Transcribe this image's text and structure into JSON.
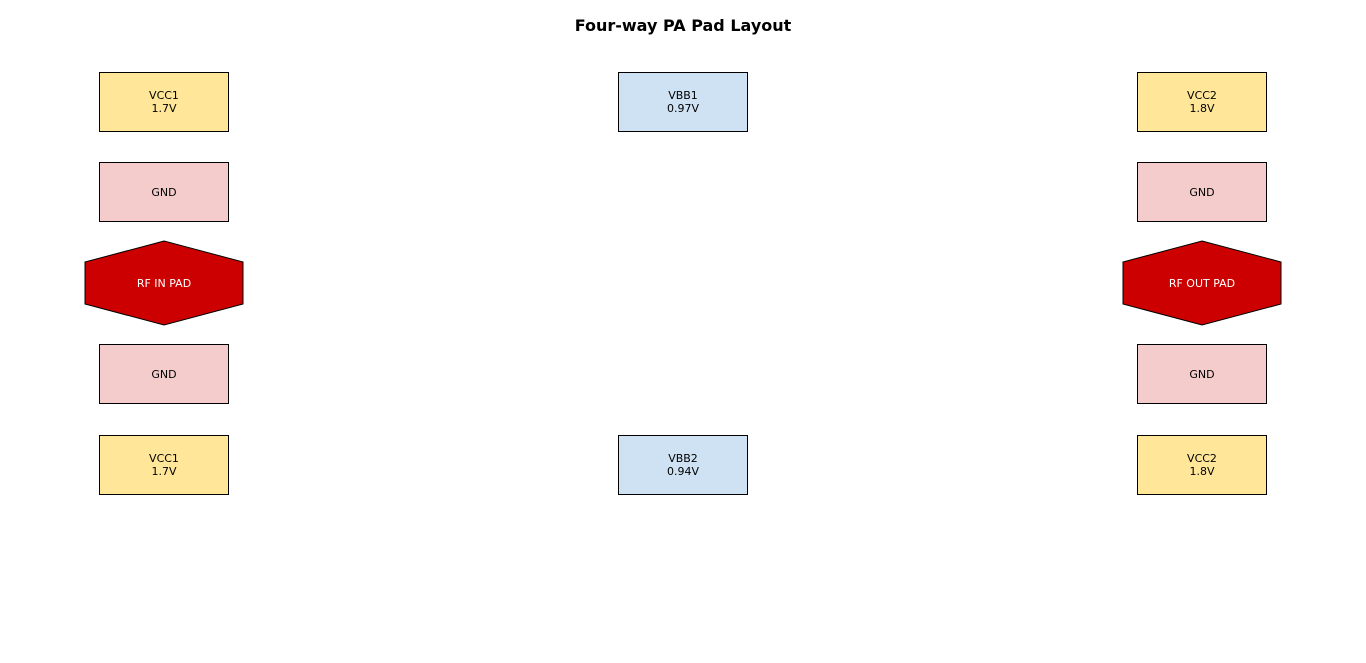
{
  "title": "Four-way PA Pad Layout",
  "colors": {
    "vcc": "#ffe699",
    "gnd": "#f4cccc",
    "vbb": "#cfe2f3",
    "rf": "#cc0000"
  },
  "pads": {
    "vcc1_top": {
      "name": "VCC1",
      "value": "1.7V"
    },
    "gnd_left_top": {
      "name": "GND"
    },
    "rf_in": {
      "name": "RF IN PAD"
    },
    "gnd_left_bottom": {
      "name": "GND"
    },
    "vcc1_bottom": {
      "name": "VCC1",
      "value": "1.7V"
    },
    "vbb1": {
      "name": "VBB1",
      "value": "0.97V"
    },
    "vbb2": {
      "name": "VBB2",
      "value": "0.94V"
    },
    "vcc2_top": {
      "name": "VCC2",
      "value": "1.8V"
    },
    "gnd_right_top": {
      "name": "GND"
    },
    "rf_out": {
      "name": "RF OUT PAD"
    },
    "gnd_right_bottom": {
      "name": "GND"
    },
    "vcc2_bottom": {
      "name": "VCC2",
      "value": "1.8V"
    }
  }
}
